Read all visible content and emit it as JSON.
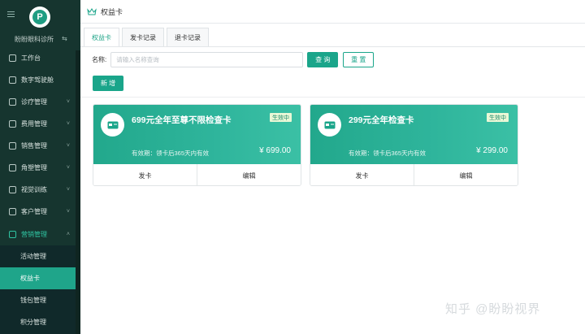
{
  "sidebar": {
    "org_name": "盼盼眼科诊所",
    "items": [
      {
        "label": "工作台",
        "icon": "dashboard-icon",
        "chevron": ""
      },
      {
        "label": "数字驾驶舱",
        "icon": "cockpit-icon",
        "chevron": ""
      },
      {
        "label": "诊疗管理",
        "icon": "clinic-icon",
        "chevron": "˅"
      },
      {
        "label": "费用管理",
        "icon": "fee-icon",
        "chevron": "˅"
      },
      {
        "label": "销售管理",
        "icon": "sales-icon",
        "chevron": "˅"
      },
      {
        "label": "角塑管理",
        "icon": "lens-icon",
        "chevron": "˅"
      },
      {
        "label": "视觉训练",
        "icon": "vision-icon",
        "chevron": "˅"
      },
      {
        "label": "客户管理",
        "icon": "customer-icon",
        "chevron": "˅"
      },
      {
        "label": "营销管理",
        "icon": "marketing-icon",
        "chevron": "˄"
      }
    ],
    "sub_items": [
      {
        "label": "活动管理"
      },
      {
        "label": "权益卡"
      },
      {
        "label": "钱包管理"
      },
      {
        "label": "积分管理"
      }
    ]
  },
  "breadcrumb": {
    "title": "权益卡"
  },
  "tabs": [
    {
      "label": "权益卡"
    },
    {
      "label": "发卡记录"
    },
    {
      "label": "退卡记录"
    }
  ],
  "search": {
    "label": "名称:",
    "placeholder": "请输入名称查询",
    "query_label": "查 询",
    "reset_label": "重 置"
  },
  "add_label": "新 增",
  "cards": [
    {
      "title": "699元全年至尊不限检查卡",
      "status": "生效中",
      "validity": "有效期：领卡后365天内有效",
      "price": "¥ 699.00",
      "issue_label": "发卡",
      "edit_label": "编辑"
    },
    {
      "title": "299元全年检查卡",
      "status": "生效中",
      "validity": "有效期：领卡后365天内有效",
      "price": "¥ 299.00",
      "issue_label": "发卡",
      "edit_label": "编辑"
    }
  ],
  "watermark": "知乎 @盼盼视界",
  "colors": {
    "sidebar_bg": "#16352f",
    "accent": "#1aa58a",
    "card_gradient_start": "#22a88c",
    "badge_bg": "#e9f7d6"
  }
}
